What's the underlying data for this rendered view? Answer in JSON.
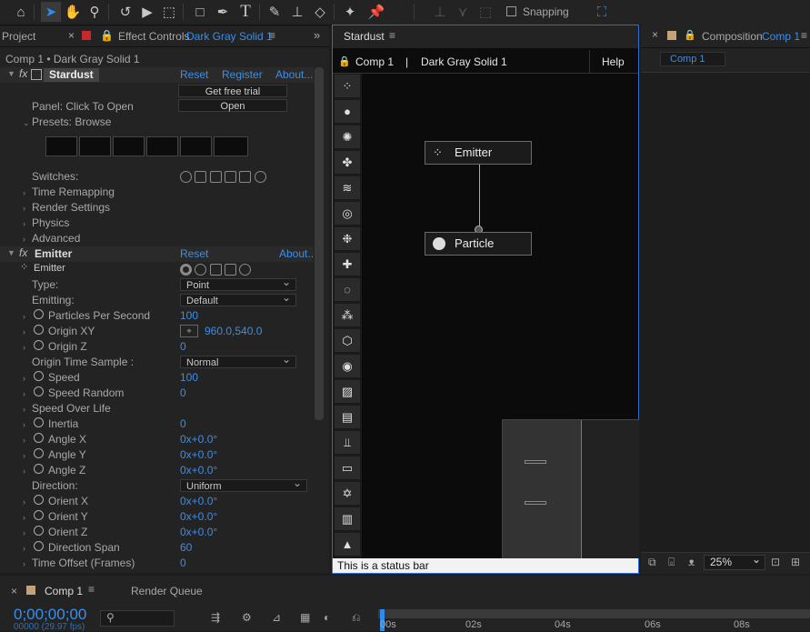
{
  "toolbar": {
    "tools": [
      "home-icon",
      "selection-arrow-icon",
      "hand-icon",
      "zoom-icon",
      "rotate-icon",
      "camera-icon",
      "pan-behind-icon",
      "rectangle-icon",
      "pen-icon",
      "type-icon",
      "brush-icon",
      "clone-stamp-icon",
      "eraser-icon",
      "roto-brush-icon",
      "puppet-pin-icon"
    ],
    "snapping_label": "Snapping"
  },
  "left_panel": {
    "tab_project": "Project",
    "tab_effect_controls": "Effect Controls",
    "tab_layer_name": "Dark Gray Solid 1",
    "breadcrumb": "Comp 1 • Dark Gray Solid 1",
    "stardust": {
      "name": "Stardust",
      "reset": "Reset",
      "register": "Register",
      "about": "About...",
      "get_free_trial": "Get free trial",
      "panel_label": "Panel: Click To Open",
      "open": "Open",
      "presets_label": "Presets: Browse",
      "switches_label": "Switches:",
      "time_remapping": "Time Remapping",
      "render_settings": "Render Settings",
      "physics": "Physics",
      "advanced": "Advanced"
    },
    "emitter": {
      "name": "Emitter",
      "reset": "Reset",
      "about": "About...",
      "sub_label": "Emitter",
      "params": [
        {
          "label": "Type:",
          "value": "Point",
          "kind": "dropdown"
        },
        {
          "label": "Emitting:",
          "value": "Default",
          "kind": "dropdown"
        },
        {
          "label": "Particles Per Second",
          "value": "100",
          "kind": "num",
          "stopwatch": true,
          "twirl": true
        },
        {
          "label": "Origin XY",
          "value": "960.0,540.0",
          "kind": "point",
          "stopwatch": true,
          "twirl": true
        },
        {
          "label": "Origin Z",
          "value": "0",
          "kind": "num",
          "stopwatch": true,
          "twirl": true
        },
        {
          "label": "Origin Time Sample :",
          "value": "Normal",
          "kind": "dropdown"
        },
        {
          "label": "Speed",
          "value": "100",
          "kind": "num",
          "stopwatch": true,
          "twirl": true
        },
        {
          "label": "Speed Random",
          "value": "0",
          "kind": "num",
          "stopwatch": true,
          "twirl": true
        },
        {
          "label": "Speed Over Life",
          "value": "",
          "kind": "group",
          "twirl": true
        },
        {
          "label": "Inertia",
          "value": "0",
          "kind": "num",
          "stopwatch": true,
          "twirl": true
        },
        {
          "label": "Angle X",
          "value": "0x+0.0°",
          "kind": "num",
          "stopwatch": true,
          "twirl": true
        },
        {
          "label": "Angle Y",
          "value": "0x+0.0°",
          "kind": "num",
          "stopwatch": true,
          "twirl": true
        },
        {
          "label": "Angle Z",
          "value": "0x+0.0°",
          "kind": "num",
          "stopwatch": true,
          "twirl": true
        },
        {
          "label": "Direction:",
          "value": "Uniform",
          "kind": "dropdown-wide"
        },
        {
          "label": "Orient X",
          "value": "0x+0.0°",
          "kind": "num",
          "stopwatch": true,
          "twirl": true
        },
        {
          "label": "Orient Y",
          "value": "0x+0.0°",
          "kind": "num",
          "stopwatch": true,
          "twirl": true
        },
        {
          "label": "Orient Z",
          "value": "0x+0.0°",
          "kind": "num",
          "stopwatch": true,
          "twirl": true
        },
        {
          "label": "Direction Span",
          "value": "60",
          "kind": "num",
          "stopwatch": true,
          "twirl": true
        },
        {
          "label": "Time Offset (Frames)",
          "value": "0",
          "kind": "num",
          "twirl": true
        }
      ]
    }
  },
  "stardust_panel": {
    "tab_title": "Stardust",
    "comp_label": "Comp 1",
    "separator": "|",
    "layer_label": "Dark Gray Solid 1",
    "help": "Help",
    "nodes": {
      "emitter": "Emitter",
      "particle": "Particle"
    },
    "status_bar": "This is a status bar",
    "tools": [
      "emitter-tool-icon",
      "particle-tool-icon",
      "burst-tool-icon",
      "fan-tool-icon",
      "wave-tool-icon",
      "ripple-tool-icon",
      "scatter-tool-icon",
      "plus-tool-icon",
      "circle-dash-tool-icon",
      "clusters-tool-icon",
      "cube-tool-icon",
      "sphere-tool-icon",
      "mask-tool-icon",
      "layer-tool-icon",
      "replicator-tool-icon",
      "rect-tool-icon",
      "atom-tool-icon",
      "bars-tool-icon",
      "light-tool-icon"
    ]
  },
  "comp_panel": {
    "tab_prefix": "Composition",
    "tab_comp": "Comp 1",
    "comp_button": "Comp 1",
    "zoom": "25%"
  },
  "timeline": {
    "tab_comp": "Comp 1",
    "tab_render_queue": "Render Queue",
    "timecode": "0;00;00;00",
    "frame_info": "00000 (29.97 fps)",
    "ruler": [
      "00s",
      "02s",
      "04s",
      "06s",
      "08s"
    ]
  }
}
